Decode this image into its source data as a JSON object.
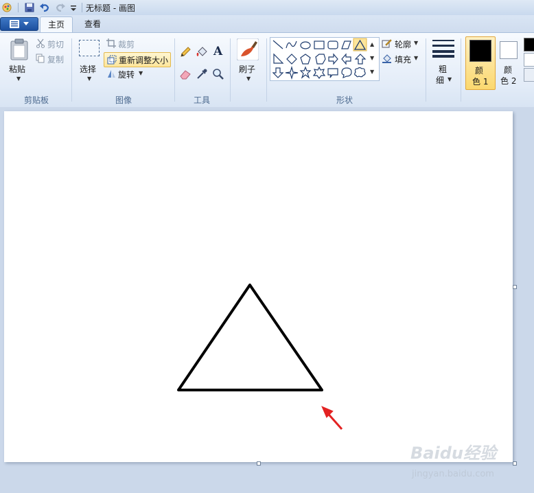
{
  "title": "无标题 - 画图",
  "tabs": {
    "home": "主页",
    "view": "查看"
  },
  "clipboard": {
    "paste": "粘贴",
    "cut": "剪切",
    "copy": "复制",
    "group": "剪贴板"
  },
  "image": {
    "select": "选择",
    "crop": "裁剪",
    "resize": "重新调整大小",
    "rotate": "旋转",
    "group": "图像"
  },
  "tools": {
    "group": "工具",
    "text_glyph": "A"
  },
  "brushes": {
    "label": "刷子"
  },
  "shapes": {
    "outline": "轮廓",
    "fill": "填充",
    "group": "形状"
  },
  "size": {
    "label_line1": "粗",
    "label_line2": "细"
  },
  "colors": {
    "color1_line1": "颜",
    "color1_line2": "色 1",
    "color2_line1": "颜",
    "color2_line2": "色 2",
    "color1": "#000000",
    "color2": "#ffffff"
  },
  "watermark": {
    "brand": "Baidu经验",
    "url": "jingyan.baidu.com"
  },
  "accent": {
    "highlight": "#fbd86f",
    "arrow": "#e32222"
  }
}
